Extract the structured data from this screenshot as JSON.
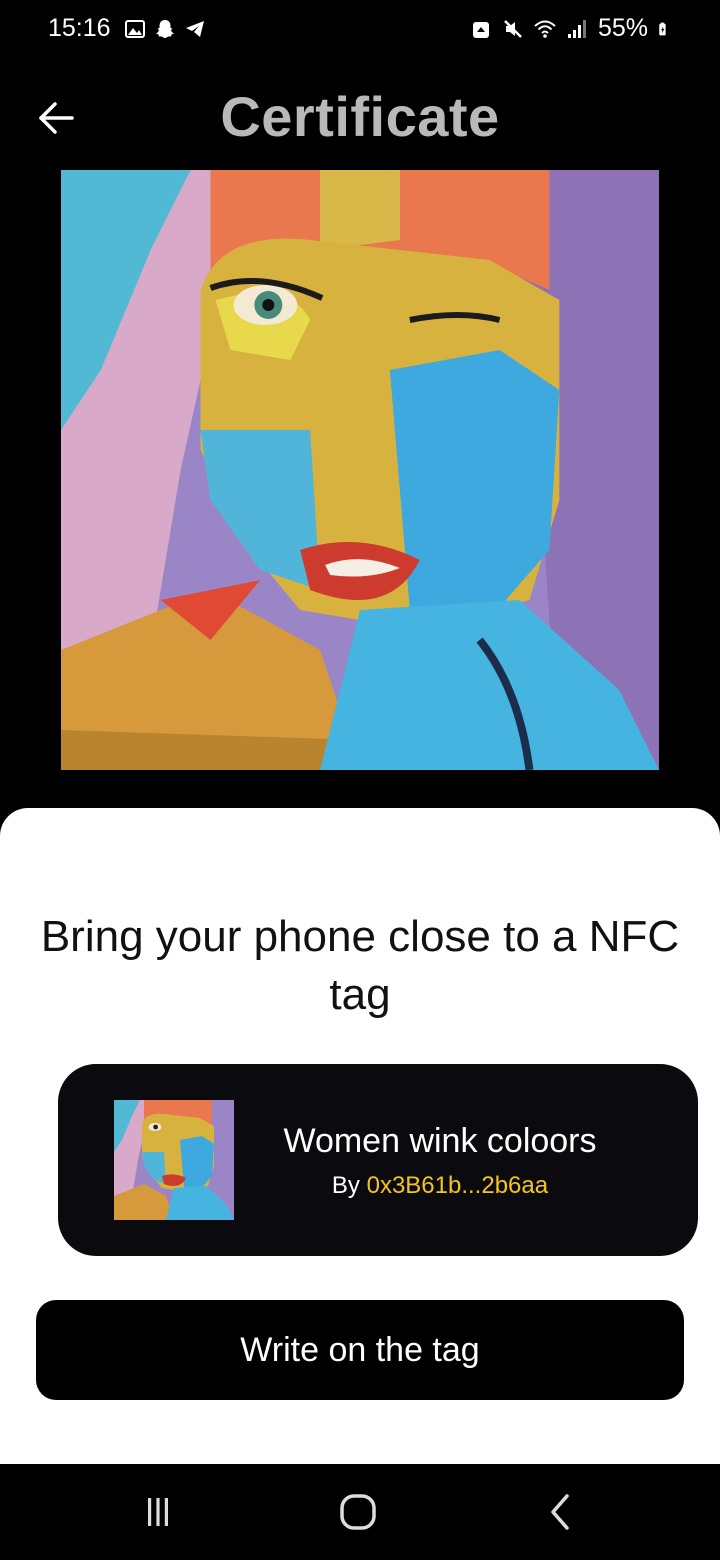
{
  "status_bar": {
    "time": "15:16",
    "battery": "55%",
    "left_icons": [
      "gallery-icon",
      "snapchat-icon",
      "telegram-icon"
    ],
    "right_icons": [
      "nfc-lock-icon",
      "mute-icon",
      "wifi-icon",
      "signal-icon",
      "battery-charging-icon"
    ]
  },
  "header": {
    "title": "Certificate",
    "back_icon": "arrow-left-icon"
  },
  "sheet": {
    "title": "Bring your phone close to a NFC tag",
    "nft": {
      "name": "Women wink coloors",
      "by_label": "By",
      "address": "0x3B61b...2b6aa"
    },
    "write_button": "Write on the tag"
  },
  "nav": {
    "recents_icon": "recents-icon",
    "home_icon": "home-icon",
    "back_icon": "back-chevron-icon"
  },
  "colors": {
    "title_gray": "#b9b9b9",
    "accent_yellow": "#f5c518",
    "card_bg": "#0b0b0f",
    "sheet_bg": "#ffffff"
  }
}
